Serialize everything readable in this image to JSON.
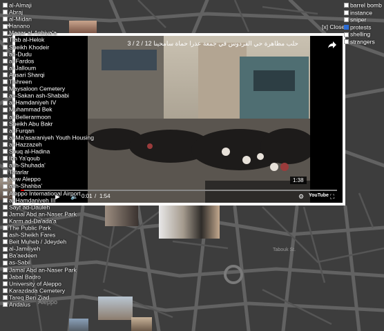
{
  "neighborhoods": [
    "al-Almaji",
    "Abraj",
    "al-Midan",
    "Hanano",
    "Maqar al-Anbiya'a",
    "Trab al-Helok",
    "Sheikh Khodeir",
    "ad-Dudu",
    "al-Fardos",
    "al-Jalloum",
    "Ansari Sharqi",
    "Tishreen",
    "Maysaloon Cemetery",
    "as-Sakan ash-Shababi",
    "al-Hamdaniyeh IV",
    "Muhammad Bek",
    "al-Bellerarmoon",
    "Sheikh Abu Bakr",
    "al-Furqan",
    "al-Ma'asaraniyeh Youth Housing",
    "al-Hazzazeh",
    "Souq al-Hadina",
    "Ibn Ya'qoub",
    "ash-Shuhada'",
    "Tatarlar",
    "New Aleppo",
    "ash-Shahba'",
    "Aleppo International Airport",
    "al-Hamdaniyeh III",
    "Sayf ad-Dauleh",
    "Jamal Abd an-Naser Park",
    "Karm ad-Da'ada'a",
    "The Public Park",
    "ash-Sheikh Fares",
    "Beit Muheb / Jdeydeh",
    "al-Jamiliyeh",
    "Ba'aedeen",
    "as-Sabil",
    "Jamal Abd an-Naser Park",
    "Jabal Badro",
    "University of Aleppo",
    "Karazdada Cemetery",
    "Tareq Ben Ziad",
    "Andalus"
  ],
  "filters": [
    {
      "label": "barrel bomb",
      "checked": false
    },
    {
      "label": "instance",
      "checked": false
    },
    {
      "label": "sniper",
      "checked": false
    },
    {
      "label": "protests",
      "checked": true
    },
    {
      "label": "shelling",
      "checked": false
    },
    {
      "label": "strangers",
      "checked": false
    }
  ],
  "zoom": {
    "in": "+",
    "out": "−"
  },
  "close_label": "[x] Close",
  "video": {
    "title": "حلب مظاهرة حي الفردوس في جمعة عذرا حماة سامحينا 12 / 2 / 3",
    "current_time": "0:01",
    "duration": "1:54",
    "badge_time": "1:38",
    "logo": "YouTube",
    "progress": 0.01
  },
  "map_labels": [
    "Aleppo",
    "Tabouk St."
  ],
  "colors": {
    "map_bg": "#3d3d3d",
    "road": "#6b6b6b",
    "road_major": "#7d7d7d",
    "accent": "#2b6cd6"
  }
}
